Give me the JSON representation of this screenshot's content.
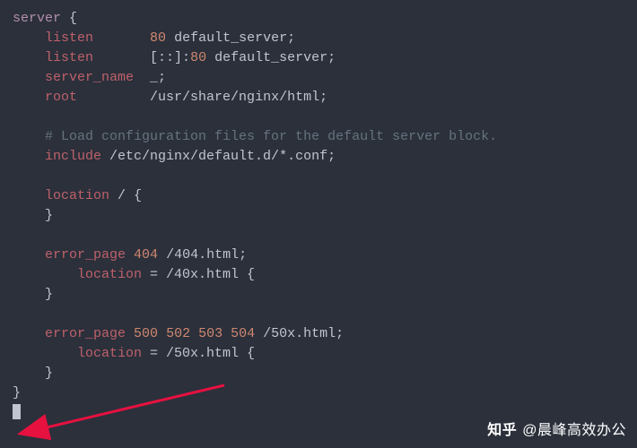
{
  "code": {
    "l1_a": "server",
    "l1_b": " {",
    "l2_a": "    ",
    "l2_b": "listen",
    "l2_c": "       ",
    "l2_d": "80",
    "l2_e": " default_server;",
    "l3_a": "    ",
    "l3_b": "listen",
    "l3_c": "       [::]:",
    "l3_d": "80",
    "l3_e": " default_server;",
    "l4_a": "    ",
    "l4_b": "server_name",
    "l4_c": "  _;",
    "l5_a": "    ",
    "l5_b": "root",
    "l5_c": "         /usr/share/nginx/html;",
    "l6": "",
    "l7_a": "    ",
    "l7_b": "# Load configuration files for the default server block.",
    "l8_a": "    ",
    "l8_b": "include",
    "l8_c": " /etc/nginx/default.d/*.conf;",
    "l9": "",
    "l10_a": "    ",
    "l10_b": "location",
    "l10_c": " / {",
    "l11": "    }",
    "l12": "",
    "l13_a": "    ",
    "l13_b": "error_page",
    "l13_c": " ",
    "l13_d": "404",
    "l13_e": " /404.html;",
    "l14_a": "        ",
    "l14_b": "location",
    "l14_c": " = /40x.html {",
    "l15": "    }",
    "l16": "",
    "l17_a": "    ",
    "l17_b": "error_page",
    "l17_c": " ",
    "l17_d": "500",
    "l17_e": " ",
    "l17_f": "502",
    "l17_g": " ",
    "l17_h": "503",
    "l17_i": " ",
    "l17_j": "504",
    "l17_k": " /50x.html;",
    "l18_a": "        ",
    "l18_b": "location",
    "l18_c": " = /50x.html {",
    "l19": "    }",
    "l20": "}"
  },
  "watermark": {
    "brand": "知乎",
    "author": "@晨峰高效办公"
  }
}
